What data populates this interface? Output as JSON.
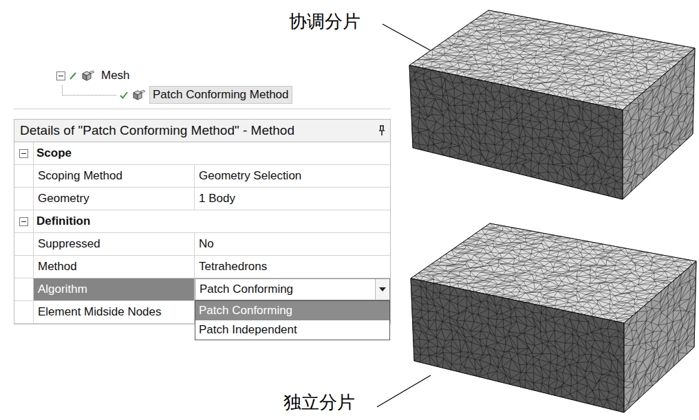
{
  "tree": [
    {
      "label": "Mesh",
      "expanded": true,
      "selected": false,
      "checked": false,
      "children": [
        {
          "label": "Patch Conforming Method",
          "expanded": false,
          "selected": true,
          "checked": true,
          "children": []
        }
      ]
    }
  ],
  "details": {
    "title": "Details of \"Patch Conforming Method\" - Method",
    "sections": [
      {
        "label": "Scope",
        "expanded": true,
        "rows": [
          {
            "label": "Scoping Method",
            "value": "Geometry Selection",
            "kind": "text",
            "selected": false
          },
          {
            "label": "Geometry",
            "value": "1 Body",
            "kind": "text",
            "selected": false
          }
        ]
      },
      {
        "label": "Definition",
        "expanded": true,
        "rows": [
          {
            "label": "Suppressed",
            "value": "No",
            "kind": "text",
            "selected": false
          },
          {
            "label": "Method",
            "value": "Tetrahedrons",
            "kind": "text",
            "selected": false
          },
          {
            "label": "Algorithm",
            "value": "Patch Conforming",
            "kind": "dropdown",
            "selected": true,
            "open": true,
            "options": [
              {
                "label": "Patch Conforming",
                "selected": true
              },
              {
                "label": "Patch Independent",
                "selected": false
              }
            ]
          },
          {
            "label": "Element Midside Nodes",
            "value": "",
            "kind": "text",
            "selected": false
          }
        ]
      }
    ]
  },
  "figures": [
    {
      "label": "协调分片"
    },
    {
      "label": "独立分片"
    }
  ]
}
